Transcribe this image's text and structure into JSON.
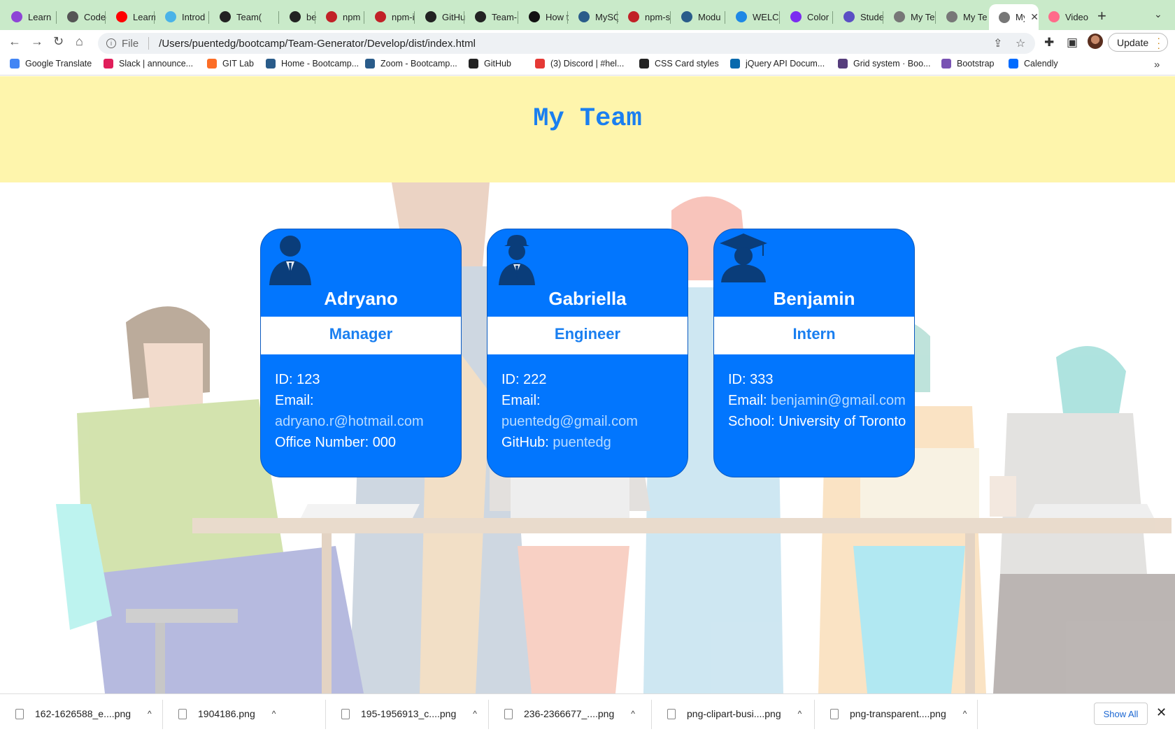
{
  "browser": {
    "tabs": [
      {
        "title": "Learn",
        "color": "#8e44d6"
      },
      {
        "title": "Codec",
        "color": "#555555"
      },
      {
        "title": "Learn",
        "color": "#ff0000"
      },
      {
        "title": "Introd",
        "color": "#4ab3e8"
      },
      {
        "title": "Team(",
        "color": "#222222"
      },
      {
        "title": "bestte",
        "color": "#222222"
      },
      {
        "title": "npm",
        "color": "#c12127"
      },
      {
        "title": "npm-i",
        "color": "#c12127"
      },
      {
        "title": "GitHu",
        "color": "#222222"
      },
      {
        "title": "Team-",
        "color": "#222222"
      },
      {
        "title": "How t",
        "color": "#111111"
      },
      {
        "title": "MySQ",
        "color": "#2a5c8a"
      },
      {
        "title": "npm-s",
        "color": "#c12127"
      },
      {
        "title": "Modu",
        "color": "#2a5c8a"
      },
      {
        "title": "WELC",
        "color": "#1e88e5"
      },
      {
        "title": "Color",
        "color": "#7b2cf0"
      },
      {
        "title": "Stude",
        "color": "#5b4fc4"
      },
      {
        "title": "My Te",
        "color": "#777777"
      },
      {
        "title": "My Te",
        "color": "#777777"
      },
      {
        "title": "My",
        "color": "#777777",
        "active": true
      },
      {
        "title": "Video",
        "color": "#ff6b8a"
      }
    ],
    "close_glyph": "✕",
    "new_tab_glyph": "+",
    "tab_menu_glyph": "⌄",
    "url_scheme": "File",
    "url": "/Users/puentedg/bootcamp/Team-Generator/Develop/dist/index.html",
    "update_label": "Update",
    "bookmarks": [
      {
        "label": "Google Translate",
        "color": "#4285f4"
      },
      {
        "label": "Slack | announce...",
        "color": "#e01e5a"
      },
      {
        "label": "GIT Lab",
        "color": "#fc6d26"
      },
      {
        "label": "Home - Bootcamp...",
        "color": "#2a5c8a"
      },
      {
        "label": "Zoom - Bootcamp...",
        "color": "#2a5c8a"
      },
      {
        "label": "GitHub",
        "color": "#222222"
      },
      {
        "label": "(3) Discord | #hel...",
        "color": "#e53935"
      },
      {
        "label": "CSS Card styles",
        "color": "#222222"
      },
      {
        "label": "jQuery API Docum...",
        "color": "#0769ad"
      },
      {
        "label": "Grid system · Boo...",
        "color": "#563d7c"
      },
      {
        "label": "Bootstrap",
        "color": "#7952b3"
      },
      {
        "label": "Calendly",
        "color": "#006bff"
      }
    ],
    "bookmarks_more": "»"
  },
  "page": {
    "title": "My Team",
    "accent_color": "#0276fe",
    "header_bg": "#fef5ac",
    "cards": [
      {
        "name": "Adryano",
        "role": "Manager",
        "icon": "manager-icon",
        "id_line": "ID: 123",
        "email_label": "Email:",
        "email": "adryano.r@hotmail.com",
        "extra_label": "Office Number:",
        "extra_value": "000"
      },
      {
        "name": "Gabriella",
        "role": "Engineer",
        "icon": "engineer-icon",
        "id_line": "ID: 222",
        "email_label": "Email:",
        "email": "puentedg@gmail.com",
        "extra_label": "GitHub:",
        "extra_value": "puentedg"
      },
      {
        "name": "Benjamin",
        "role": "Intern",
        "icon": "intern-icon",
        "id_line": "ID: 333",
        "email_label": "Email:",
        "email": "benjamin@gmail.com",
        "extra_label": "School:",
        "extra_value": "University of Toronto"
      }
    ]
  },
  "downloads": {
    "items": [
      "162-1626588_e....png",
      "1904186.png",
      "195-1956913_c....png",
      "236-2366677_....png",
      "png-clipart-busi....png",
      "png-transparent....png"
    ],
    "show_all": "Show All",
    "close_glyph": "✕",
    "chevron_glyph": "^"
  }
}
